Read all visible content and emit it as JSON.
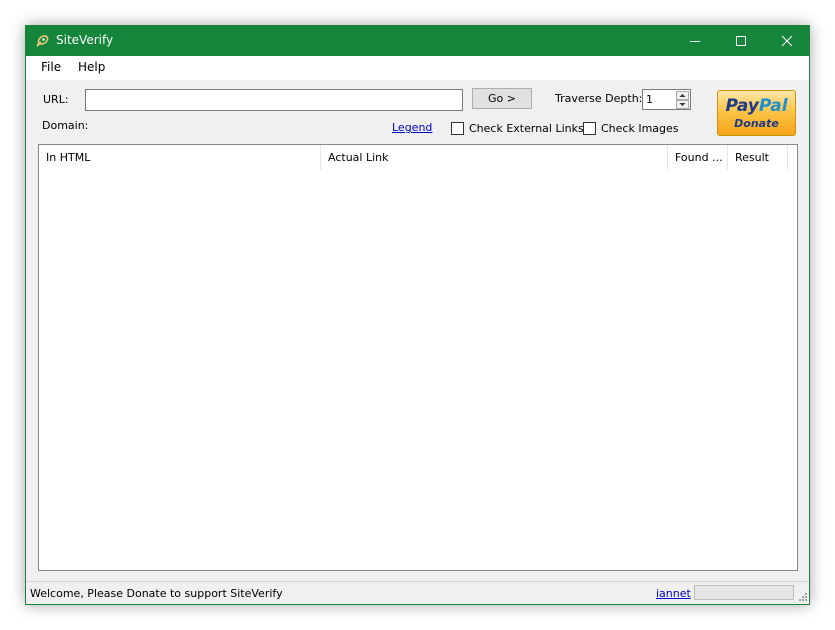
{
  "window": {
    "title": "SiteVerify",
    "accent_color": "#14853a"
  },
  "menu": {
    "items": [
      {
        "label": "File"
      },
      {
        "label": "Help"
      }
    ]
  },
  "form": {
    "url_label": "URL:",
    "url_value": "",
    "domain_label": "Domain:",
    "go_label": "Go >",
    "depth_label": "Traverse Depth:",
    "depth_value": "1",
    "legend_link": "Legend",
    "check_external_label": "Check External Links",
    "check_external_checked": false,
    "check_images_label": "Check Images",
    "check_images_checked": false
  },
  "paypal": {
    "logo_pay": "Pay",
    "logo_pal": "Pal",
    "sub_label": "Donate"
  },
  "table": {
    "columns": [
      {
        "label": "In HTML"
      },
      {
        "label": "Actual Link"
      },
      {
        "label": "Found ..."
      },
      {
        "label": "Result"
      }
    ],
    "rows": []
  },
  "status": {
    "message": "Welcome, Please Donate to support SiteVerify",
    "link": "iannet"
  },
  "icons": [
    "app-icon",
    "minimize-icon",
    "maximize-icon",
    "close-icon",
    "spin-up-icon",
    "spin-down-icon",
    "resize-grip-icon"
  ]
}
